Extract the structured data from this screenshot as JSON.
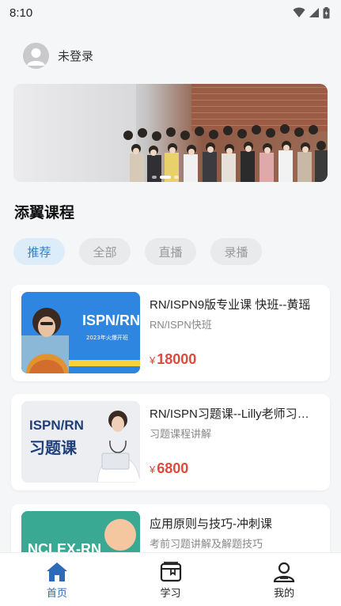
{
  "status_bar": {
    "time": "8:10"
  },
  "user": {
    "name": "未登录"
  },
  "banner": {
    "page_count": 3,
    "active_page": 2
  },
  "section": {
    "title": "添翼课程"
  },
  "filters": [
    {
      "label": "推荐",
      "active": true
    },
    {
      "label": "全部",
      "active": false
    },
    {
      "label": "直播",
      "active": false
    },
    {
      "label": "录播",
      "active": false
    }
  ],
  "courses": [
    {
      "title": "RN/ISPN9版专业课 快班--黄瑶",
      "subtitle": "RN/ISPN快班",
      "currency": "¥",
      "price": "18000",
      "thumb_text": "ISPN/RN",
      "thumb_caption": "2023年火爆开班"
    },
    {
      "title": "RN/ISPN习题课--Lilly老师习题课程讲解",
      "subtitle": "习题课程讲解",
      "currency": "¥",
      "price": "6800",
      "thumb_text": "ISPN/RN",
      "thumb_text2": "习题课"
    },
    {
      "title": "应用原则与技巧-冲刺课",
      "subtitle": "考前习题讲解及解题技巧",
      "currency": "¥",
      "price": "",
      "thumb_text": "NCLEX-RN"
    }
  ],
  "tabbar": {
    "items": [
      {
        "label": "首页",
        "icon": "home-icon",
        "active": true
      },
      {
        "label": "学习",
        "icon": "book-icon",
        "active": false
      },
      {
        "label": "我的",
        "icon": "person-icon",
        "active": false
      }
    ]
  },
  "colors": {
    "accent": "#2d7fd3",
    "price": "#e04a3c",
    "chip_bg": "#e9eaec",
    "chip_active_bg": "#dcecf9"
  }
}
